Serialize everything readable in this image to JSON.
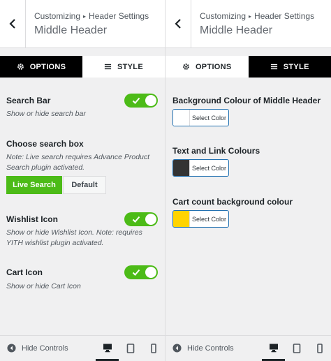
{
  "left": {
    "breadcrumb": {
      "parent": "Customizing",
      "separator": "▸",
      "section": "Header Settings"
    },
    "title": "Middle Header",
    "tabs": {
      "options": "OPTIONS",
      "style": "STYLE"
    },
    "search_bar": {
      "label": "Search Bar",
      "desc": "Show or hide search bar",
      "enabled": true
    },
    "search_box": {
      "label": "Choose search box",
      "desc": "Note: Live search requires Advance Product Search plugin activated.",
      "options": [
        "Live Search",
        "Default"
      ],
      "selected": "Live Search"
    },
    "wishlist": {
      "label": "Wishlist Icon",
      "desc": "Show or hide Wishlist Icon. Note: requires YITH wishlist plugin activated.",
      "enabled": true
    },
    "cart": {
      "label": "Cart Icon",
      "desc": "Show or hide Cart Icon",
      "enabled": true
    },
    "footer": {
      "hide_controls": "Hide Controls"
    }
  },
  "right": {
    "breadcrumb": {
      "parent": "Customizing",
      "separator": "▸",
      "section": "Header Settings"
    },
    "title": "Middle Header",
    "tabs": {
      "options": "OPTIONS",
      "style": "STYLE"
    },
    "bg_colour": {
      "label": "Background Colour of Middle Header",
      "button": "Select Color",
      "swatch": "#ffffff"
    },
    "text_link": {
      "label": "Text and Link Colours",
      "button": "Select Color",
      "swatch": "#333333"
    },
    "cart_count": {
      "label": "Cart count background colour",
      "button": "Select Color",
      "swatch": "#ffd400"
    },
    "footer": {
      "hide_controls": "Hide Controls"
    }
  },
  "colors": {
    "accent_green": "#4cbb17",
    "tab_dark": "#000000",
    "picker_border": "#2271b1"
  },
  "icons": [
    "chevron-left-icon",
    "gear-icon",
    "menu-lines-icon",
    "check-icon",
    "arrow-left-circle-icon",
    "desktop-icon",
    "tablet-icon",
    "mobile-icon"
  ]
}
